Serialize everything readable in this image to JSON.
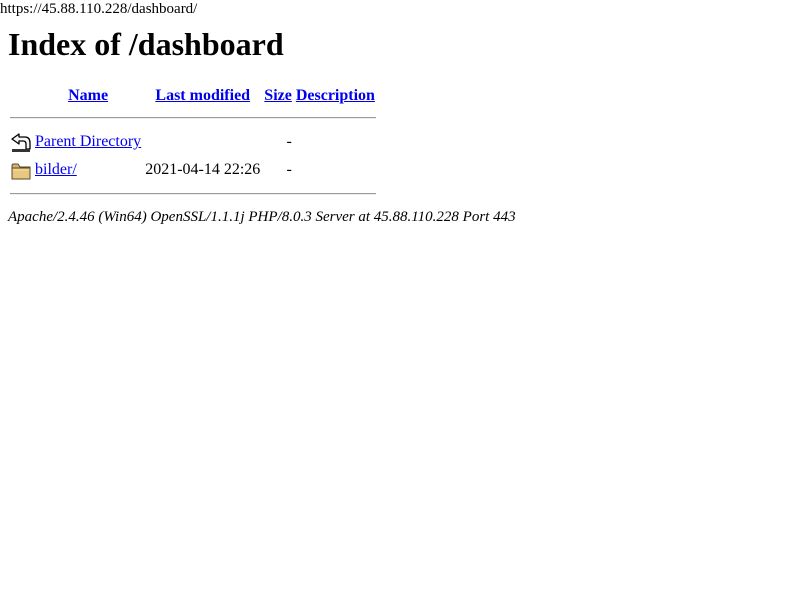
{
  "url": "https://45.88.110.228/dashboard/",
  "title": "Index of /dashboard",
  "columns": {
    "name": "Name",
    "last_modified": "Last modified",
    "size": "Size",
    "description": "Description"
  },
  "rows": [
    {
      "icon": "parent-directory-icon",
      "name": "Parent Directory",
      "last_modified": "",
      "size": "-",
      "description": ""
    },
    {
      "icon": "folder-icon",
      "name": "bilder/",
      "last_modified": "2021-04-14 22:26",
      "size": "-",
      "description": ""
    }
  ],
  "footer": "Apache/2.4.46 (Win64) OpenSSL/1.1.1j PHP/8.0.3 Server at 45.88.110.228 Port 443",
  "colors": {
    "link": "#0000ee",
    "text": "#000000",
    "background": "#ffffff"
  }
}
